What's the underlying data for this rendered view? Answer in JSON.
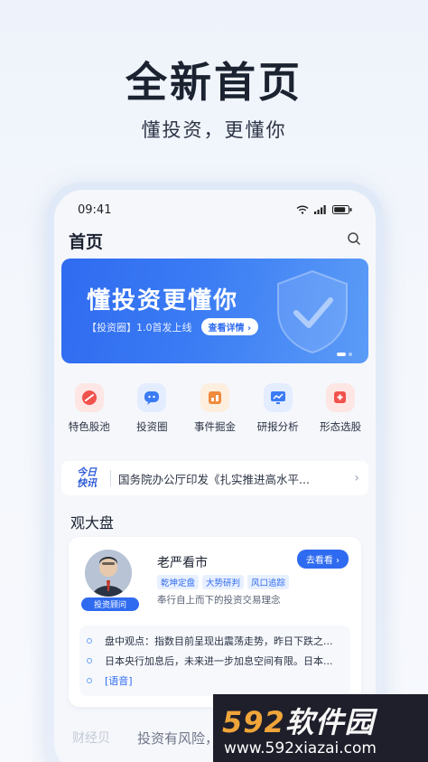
{
  "hero": {
    "title": "全新首页",
    "subtitle": "懂投资，更懂你"
  },
  "status_bar": {
    "time": "09:41"
  },
  "header": {
    "title": "首页",
    "search_icon": "search-icon"
  },
  "banner": {
    "title": "懂投资更懂你",
    "tag": "【投资圈】1.0首发上线",
    "button_label": "查看详情 ›",
    "icon": "shield-check-icon"
  },
  "quick_menu": [
    {
      "label": "特色股池",
      "icon": "stock-pool-icon",
      "color": "#f0524c"
    },
    {
      "label": "投资圈",
      "icon": "chat-bubble-icon",
      "color": "#3b7cf4"
    },
    {
      "label": "事件掘金",
      "icon": "event-icon",
      "color": "#f08a3c"
    },
    {
      "label": "研报分析",
      "icon": "report-chart-icon",
      "color": "#3b7cf4"
    },
    {
      "label": "形态选股",
      "icon": "pattern-icon",
      "color": "#f0524c"
    }
  ],
  "news": {
    "badge_line1": "今日",
    "badge_line2": "快讯",
    "text": "国务院办公厅印发《扎实推进高水平...",
    "arrow": "›"
  },
  "section": {
    "title": "观大盘"
  },
  "expert": {
    "name": "老严看市",
    "badge": "投资顾问",
    "follow_label": "去看看 ›",
    "tags": [
      "乾坤定盘",
      "大势研判",
      "风口追踪"
    ],
    "description": "奉行自上而下的投资交易理念",
    "points": [
      {
        "text": "盘中观点：指数目前呈现出震荡走势，昨日下跌之...",
        "highlight": false
      },
      {
        "text": "日本央行加息后，未来进一步加息空间有限。日本...",
        "highlight": false
      },
      {
        "text": "[语音]",
        "highlight": true
      }
    ]
  },
  "footer": {
    "faded_label": "财经贝",
    "risk_hint": "投资有风险，"
  },
  "watermark": {
    "brand_number": "592",
    "brand_text": "软件园",
    "url": "www.592xiazai.com"
  }
}
